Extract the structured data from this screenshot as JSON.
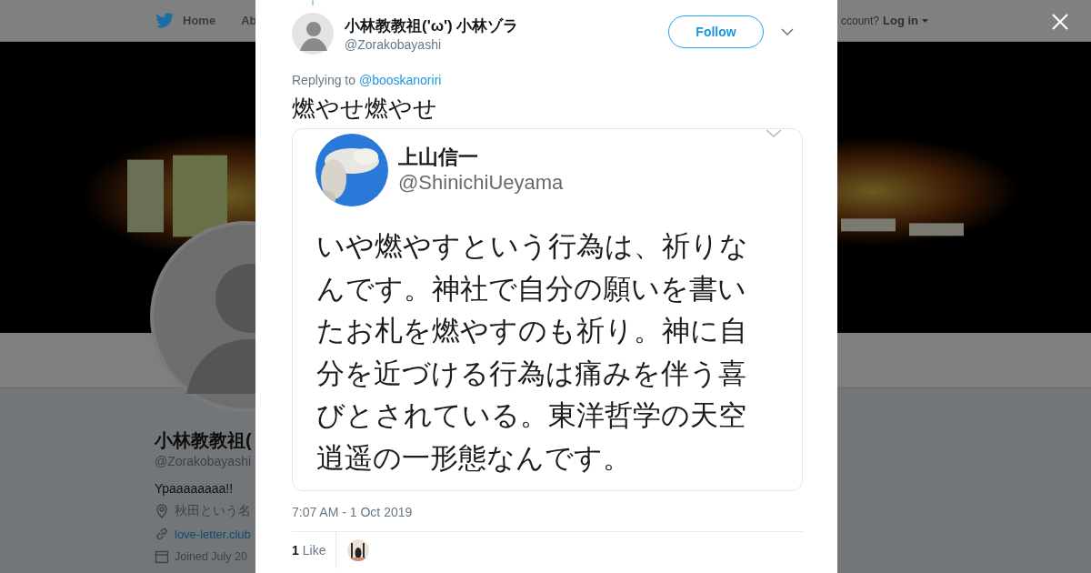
{
  "top_nav": {
    "items": [
      "Home",
      "Ab"
    ],
    "account_prompt": "ccount?",
    "login": "Log in"
  },
  "profile": {
    "name": "小林教教祖(",
    "handle": "@Zorakobayashi",
    "bio": "Ypaaaaaaaa!!",
    "location": "秋田という名",
    "url": "love-letter.club",
    "joined": "Joined July 20"
  },
  "tweet": {
    "author_name": "小林教教祖('ω') 小林ゾラ",
    "author_handle": "@Zorakobayashi",
    "follow_label": "Follow",
    "replying_label": "Replying to",
    "reply_to": "@booskanoriri",
    "text": "燃やせ燃やせ",
    "media": {
      "name": "上山信一",
      "handle": "@ShinichiUeyama",
      "text": "いや燃やすという行為は、祈りなんです。神社で自分の願いを書いたお札を燃やすのも祈り。神に自分を近づける行為は痛みを伴う喜びとされている。東洋哲学の天空逍遥の一形態なんです。"
    },
    "timestamp": "7:07 AM - 1 Oct 2019",
    "likes": {
      "count": "1",
      "label": "Like"
    }
  }
}
